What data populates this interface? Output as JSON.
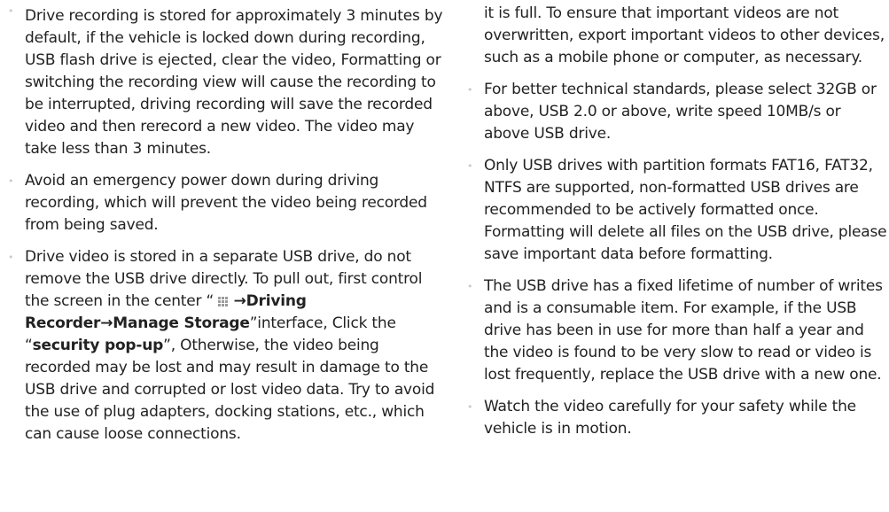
{
  "left": {
    "items": [
      {
        "text": "Drive recording is stored for approximately 3 minutes by default, if the vehicle is locked down during recording, USB flash drive is ejected, clear the video, Formatting or switching the recording view will cause the recording to be interrupted, driving recording will save the recorded video and then rerecord a new video. The video may take less than 3 minutes."
      },
      {
        "text": "Avoid an emergency power down during driving recording, which will prevent the video being recorded from being saved."
      },
      {
        "p1": "Drive video is stored in a separate USB drive, do not remove the USB drive directly. To pull out, first control the screen in the center “",
        "arrow1": "→",
        "bold1": "Driving Recorder",
        "arrow2": "→",
        "bold2": "Manage Storage",
        "p2": "”interface, Click the “",
        "bold3": "security pop-up",
        "p3": "”, Otherwise, the video being recorded may be lost and may result in damage to the USB drive and corrupted or lost video data. Try to avoid the use of plug adapters, docking stations, etc., which can cause loose connections.",
        "icon": "grid-menu-icon"
      }
    ]
  },
  "right": {
    "items": [
      {
        "text": "recorded in a loop, overwriting the oldest video when it is full. To ensure that important videos are not overwritten, export important videos to other devices, such as a mobile phone or computer, as necessary.",
        "continuation": true
      },
      {
        "text": "For better technical standards, please select 32GB or above, USB 2.0 or above, write speed 10MB/s or above USB drive."
      },
      {
        "text": "Only USB drives with partition formats FAT16, FAT32, NTFS are supported, non-formatted USB drives are recommended to be actively formatted once. Formatting will delete all files on the USB drive, please save important data before formatting."
      },
      {
        "text": "The USB drive has a fixed lifetime of number of writes and is a consumable item. For example, if the USB drive has been in use for more than half a year and the video is found to be very slow to read or video is lost frequently, replace the USB drive with a new one."
      },
      {
        "text": "Watch the video carefully for your safety while the vehicle is in motion."
      }
    ]
  },
  "bullet_glyph": "•",
  "colors": {
    "text": "#222222",
    "bullet": "#c9c9c9"
  }
}
